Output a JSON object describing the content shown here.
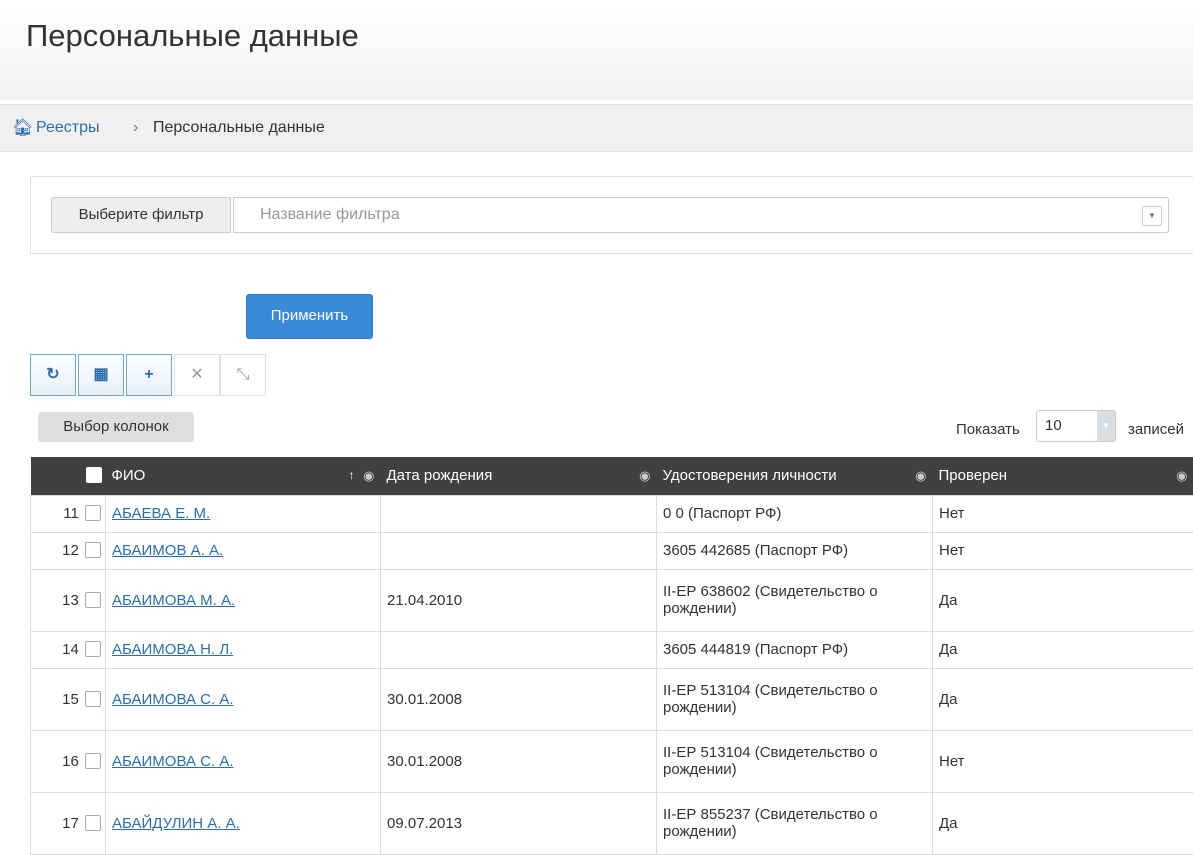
{
  "page": {
    "title": "Персональные данные"
  },
  "breadcrumb": {
    "link": "Реестры",
    "separator": "›",
    "current": "Персональные данные"
  },
  "filter": {
    "label": "Выберите фильтр",
    "placeholder": "Название фильтра",
    "apply_label": "Применить"
  },
  "toolbar": {
    "buttons": [
      {
        "name": "refresh",
        "icon": "refresh-icon",
        "glyph": "↻"
      },
      {
        "name": "columns-grid",
        "icon": "grid-icon",
        "glyph": "▦"
      },
      {
        "name": "add",
        "icon": "plus-icon",
        "glyph": "+"
      },
      {
        "name": "delete",
        "icon": "close-icon",
        "glyph": "✕"
      },
      {
        "name": "collapse",
        "icon": "collapse-icon",
        "glyph": "⤡"
      }
    ]
  },
  "columns_button": "Выбор колонок",
  "paging": {
    "show_label": "Показать",
    "page_size": "10",
    "records_label": "записей"
  },
  "table": {
    "headers": [
      "ФИО",
      "Дата рождения",
      "Удостоверения личности",
      "Проверен"
    ],
    "rows": [
      {
        "num": "11",
        "name": "АБАЕВА Е. М.",
        "birth": "",
        "id_doc": "0 0 (Паспорт РФ)",
        "checked": "Нет"
      },
      {
        "num": "12",
        "name": "АБАИМОВ А. А.",
        "birth": "",
        "id_doc": "3605 442685 (Паспорт РФ)",
        "checked": "Нет"
      },
      {
        "num": "13",
        "name": "АБАИМОВА М. А.",
        "birth": "21.04.2010",
        "id_doc": "II-ЕР 638602 (Свидетельство о рождении)",
        "checked": "Да"
      },
      {
        "num": "14",
        "name": "АБАИМОВА Н. Л.",
        "birth": "",
        "id_doc": "3605 444819 (Паспорт РФ)",
        "checked": "Да"
      },
      {
        "num": "15",
        "name": "АБАИМОВА С. А.",
        "birth": "30.01.2008",
        "id_doc": "II-ЕР 513104 (Свидетельство о рождении)",
        "checked": "Да"
      },
      {
        "num": "16",
        "name": "АБАИМОВА С. А.",
        "birth": "30.01.2008",
        "id_doc": "II-ЕР 513104 (Свидетельство о рождении)",
        "checked": "Нет"
      },
      {
        "num": "17",
        "name": "АБАЙДУЛИН А. А.",
        "birth": "09.07.2013",
        "id_doc": "II-ЕР 855237 (Свидетельство о рождении)",
        "checked": "Да"
      }
    ]
  }
}
